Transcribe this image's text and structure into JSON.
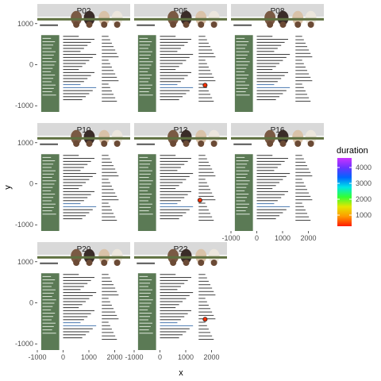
{
  "chart_data": {
    "type": "scatter",
    "background": "webpage-screenshot",
    "facets": [
      {
        "label": "P02",
        "points": []
      },
      {
        "label": "P05",
        "points": [
          {
            "x": 1750,
            "y": -500,
            "duration": 400
          }
        ]
      },
      {
        "label": "P08",
        "points": []
      },
      {
        "label": "P10",
        "points": []
      },
      {
        "label": "P13",
        "points": [
          {
            "x": 1550,
            "y": -400,
            "duration": 400
          }
        ]
      },
      {
        "label": "P16",
        "points": []
      },
      {
        "label": "P20",
        "points": []
      },
      {
        "label": "P22",
        "points": [
          {
            "x": 1750,
            "y": -400,
            "duration": 400
          }
        ]
      }
    ],
    "xlabel": "x",
    "ylabel": "y",
    "xlim": [
      -1000,
      2600
    ],
    "ylim": [
      -1150,
      1150
    ],
    "xticks": [
      -1000,
      0,
      1000,
      2000
    ],
    "yticks": [
      -1000,
      0,
      1000
    ],
    "xtick_labels": [
      "-1000",
      "0",
      "1000",
      "2000"
    ],
    "ytick_labels": [
      "-1000",
      "0",
      "1000"
    ],
    "legend": {
      "title": "duration",
      "position": "right",
      "ticks": [
        1000,
        2000,
        3000,
        4000
      ],
      "tick_labels": [
        "1000",
        "2000",
        "3000",
        "4000"
      ],
      "range": [
        300,
        4600
      ],
      "colors": [
        "#ff1a00",
        "#ff9900",
        "#e6e600",
        "#33ff33",
        "#00e6e6",
        "#0066ff",
        "#6a33ff",
        "#cc33ff"
      ]
    },
    "grid": true
  }
}
